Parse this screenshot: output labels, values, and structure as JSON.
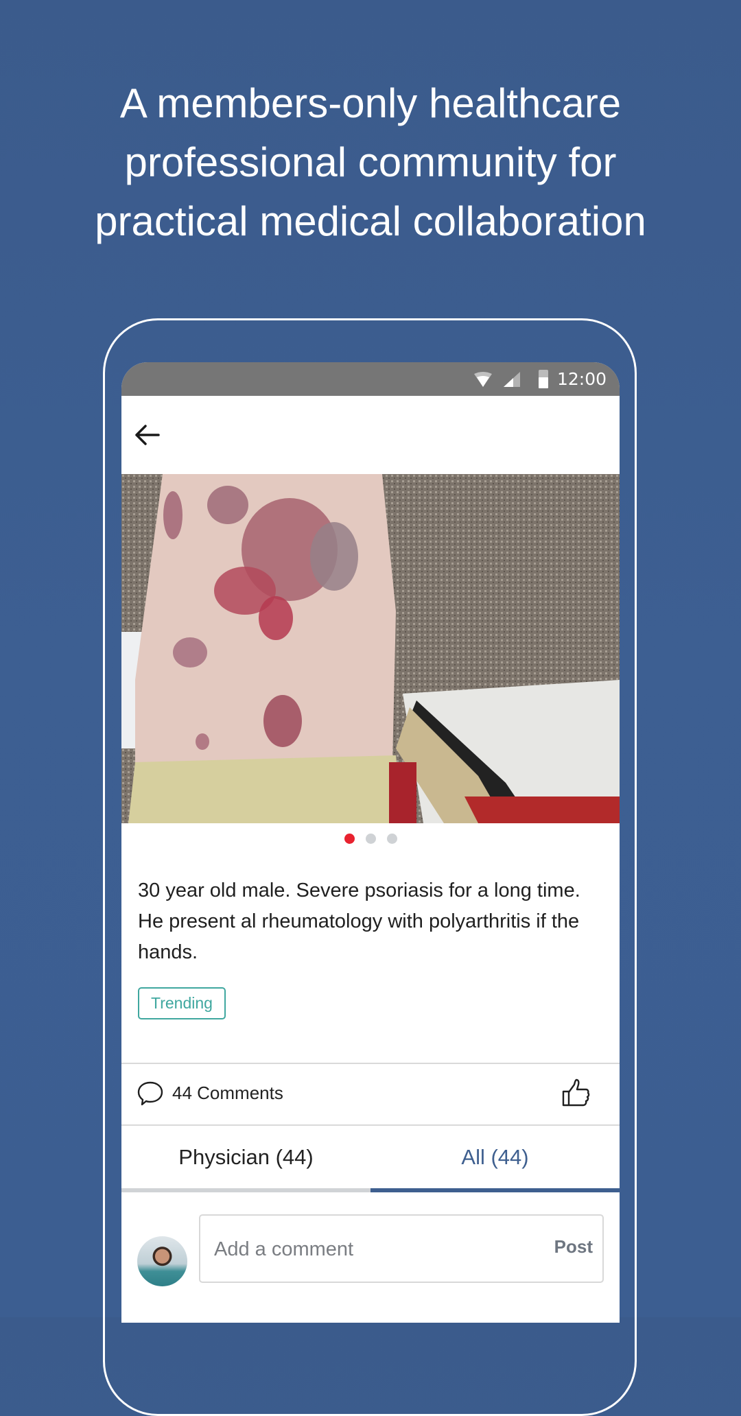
{
  "headline": {
    "line1": "A members-only healthcare",
    "line2": "professional community for",
    "line3": "practical medical collaboration"
  },
  "status_bar": {
    "time": "12:00",
    "icons": [
      "wifi-icon",
      "cellular-signal-icon",
      "battery-icon"
    ]
  },
  "app_bar": {
    "back_icon": "arrow-left-icon"
  },
  "post": {
    "image_description": "forearm with psoriasis plaques",
    "carousel": {
      "total": 3,
      "active_index": 0,
      "active_color": "#e8222f",
      "inactive_color": "#cfd2d5"
    },
    "text": "30 year old male. Severe psoriasis for a long time. He present al rheumatology with polyarthritis if the hands.",
    "tag": "Trending"
  },
  "engagement": {
    "comments_label": "44 Comments",
    "comment_icon": "speech-bubble-icon",
    "like_icon": "thumbs-up-icon"
  },
  "tabs": [
    {
      "label": "Physician (44)",
      "selected": false
    },
    {
      "label": "All (44)",
      "selected": true
    }
  ],
  "composer": {
    "placeholder": "Add a comment",
    "value": "",
    "post_label": "Post"
  },
  "colors": {
    "background": "#3c5e91",
    "accent": "#3e5f8f",
    "tag": "#3fa79f",
    "status_bar": "#767676"
  }
}
